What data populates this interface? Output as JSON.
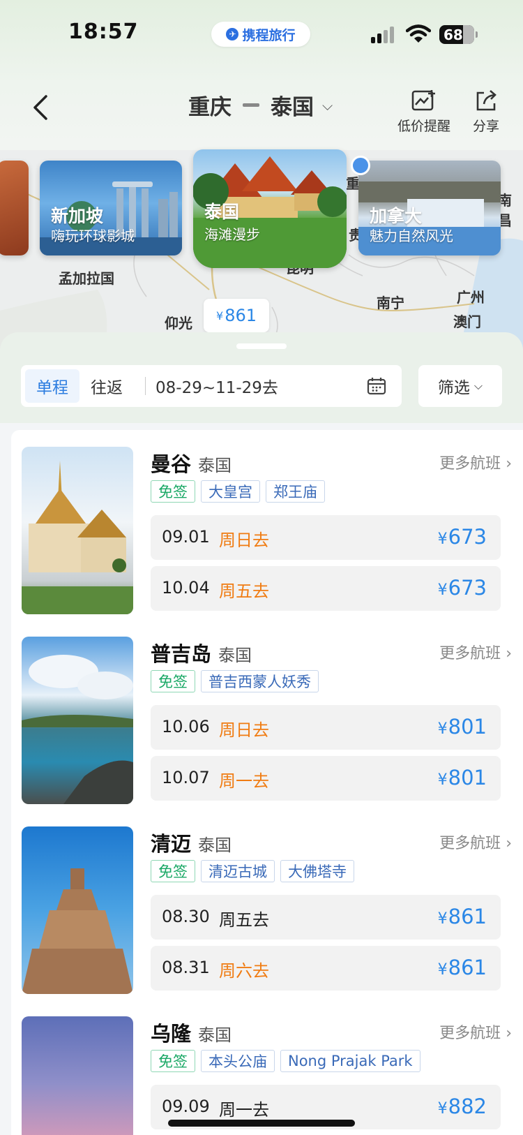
{
  "status_bar": {
    "time": "18:57",
    "app_pill": "携程旅行",
    "battery": "68"
  },
  "header": {
    "from": "重庆",
    "to": "泰国",
    "actions": [
      {
        "label": "低价提醒",
        "icon": "price-alert-icon"
      },
      {
        "label": "分享",
        "icon": "share-icon"
      }
    ]
  },
  "map": {
    "labels": [
      "孟加拉国",
      "昆明",
      "南宁",
      "广州",
      "澳门",
      "贵",
      "重",
      "南昌",
      "仰光"
    ],
    "destinations": [
      {
        "name": "新加坡",
        "subtitle": "嗨玩环球影城"
      },
      {
        "name": "泰国",
        "subtitle": "海滩漫步"
      },
      {
        "name": "加拿大",
        "subtitle": "魅力自然风光"
      }
    ],
    "price_currency": "¥",
    "price_tag": "861"
  },
  "trip": {
    "tabs": [
      "单程",
      "往返"
    ],
    "active_tab": "单程",
    "dates": "08-29~11-29去",
    "filter": "筛选"
  },
  "results": [
    {
      "city": "曼谷",
      "country": "泰国",
      "more": "更多航班",
      "tags": [
        "免签",
        "大皇宫",
        "郑王庙"
      ],
      "flights": [
        {
          "date": "09.01",
          "day": "周日去",
          "price": "673",
          "highlight": true
        },
        {
          "date": "10.04",
          "day": "周五去",
          "price": "673",
          "highlight": true
        }
      ]
    },
    {
      "city": "普吉岛",
      "country": "泰国",
      "more": "更多航班",
      "tags": [
        "免签",
        "普吉西蒙人妖秀"
      ],
      "flights": [
        {
          "date": "10.06",
          "day": "周日去",
          "price": "801",
          "highlight": true
        },
        {
          "date": "10.07",
          "day": "周一去",
          "price": "801",
          "highlight": true
        }
      ]
    },
    {
      "city": "清迈",
      "country": "泰国",
      "more": "更多航班",
      "tags": [
        "免签",
        "清迈古城",
        "大佛塔寺"
      ],
      "flights": [
        {
          "date": "08.30",
          "day": "周五去",
          "price": "861",
          "highlight": false
        },
        {
          "date": "08.31",
          "day": "周六去",
          "price": "861",
          "highlight": true
        }
      ]
    },
    {
      "city": "乌隆",
      "country": "泰国",
      "more": "更多航班",
      "tags": [
        "免签",
        "本头公庙",
        "Nong Prajak Park"
      ],
      "flights": [
        {
          "date": "09.09",
          "day": "周一去",
          "price": "882",
          "highlight": false
        }
      ]
    }
  ],
  "currency": "¥",
  "colors": {
    "accent_blue": "#2b87e6",
    "weekday_orange": "#f07c13",
    "visa_free_green": "#19a865"
  }
}
